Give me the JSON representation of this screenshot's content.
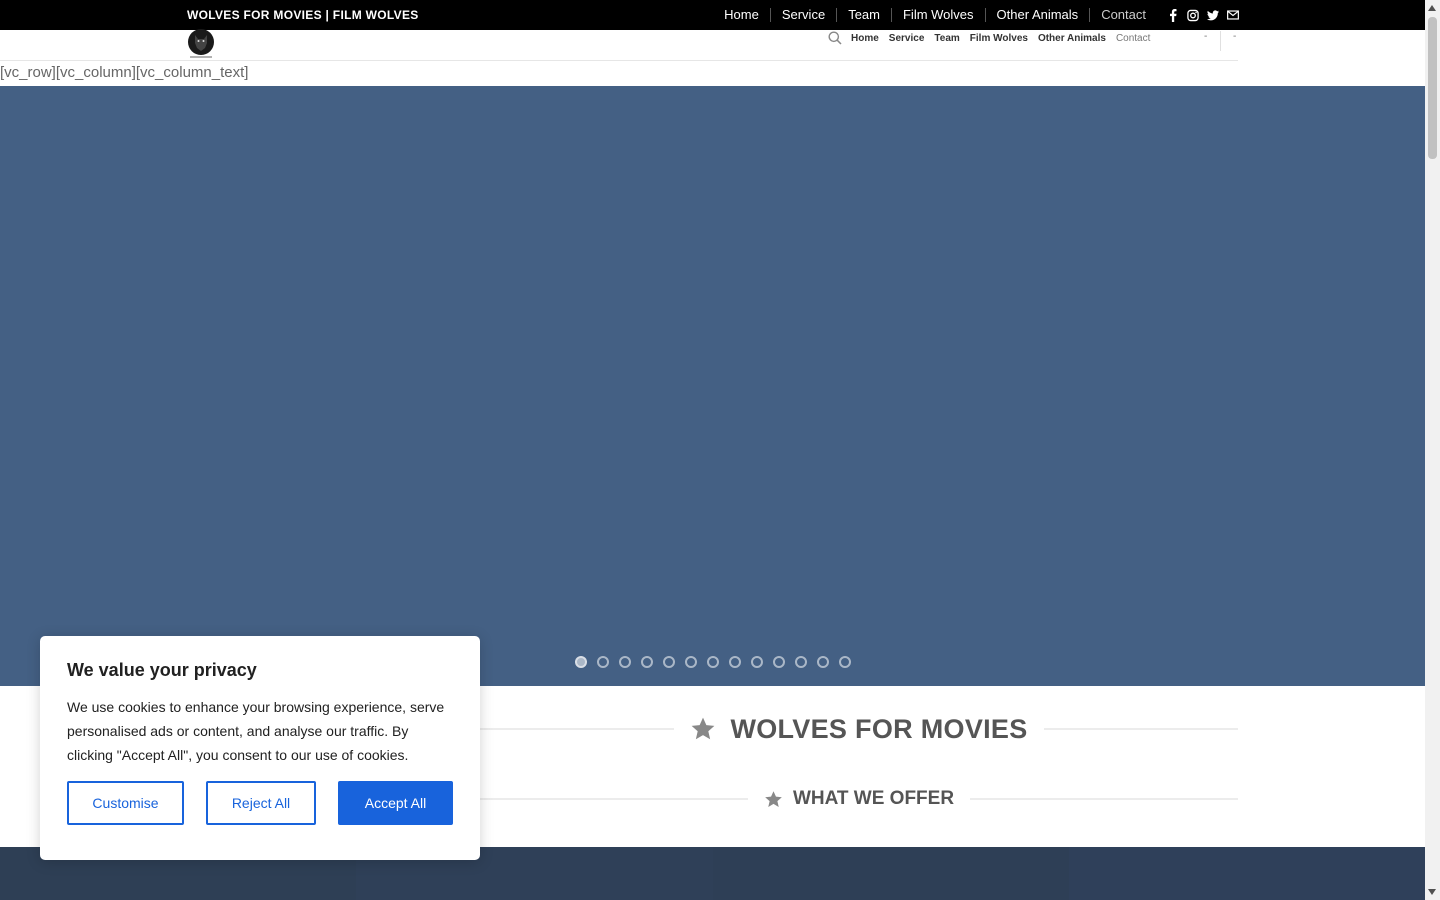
{
  "topbar": {
    "title": "WOLVES FOR MOVIES | FILM WOLVES",
    "nav": [
      "Home",
      "Service",
      "Team",
      "Film Wolves",
      "Other Animals",
      "Contact"
    ],
    "social_icons": [
      "facebook-icon",
      "instagram-icon",
      "twitter-icon",
      "mail-icon"
    ]
  },
  "header": {
    "nav": [
      "Home",
      "Service",
      "Team",
      "Film Wolves",
      "Other Animals",
      "Contact"
    ],
    "dash1": "-",
    "dash2": "-"
  },
  "shortcode_text": "[vc_row][vc_column][vc_column_text]",
  "slider": {
    "dot_count": 13,
    "active_index": 0,
    "background": "#446084"
  },
  "section": {
    "title": "WOLVES FOR MOVIES",
    "subtitle": "WHAT WE OFFER"
  },
  "cookie": {
    "title": "We value your privacy",
    "body": "We use cookies to enhance your browsing experience, serve personalised ads or content, and analyse our traffic. By clicking \"Accept All\", you consent to our use of cookies.",
    "customise": "Customise",
    "reject": "Reject All",
    "accept": "Accept All",
    "accent": "#1863dc"
  },
  "tiles_colors": [
    "#2e3f55",
    "#2f4058",
    "#2e3f56",
    "#2f405a"
  ]
}
